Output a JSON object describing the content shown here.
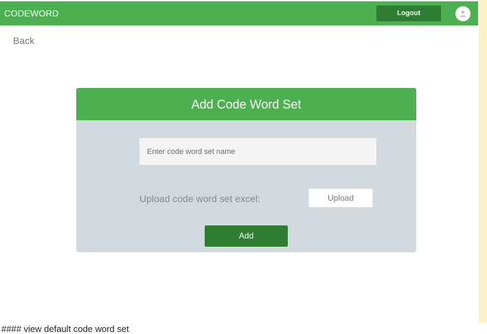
{
  "navbar": {
    "brand": "CODEWORD",
    "logout_label": "Logout",
    "avatar_icon": "user-avatar-icon"
  },
  "nav": {
    "back_label": "Back"
  },
  "form": {
    "title": "Add Code Word Set",
    "name_placeholder": "Enter code word set name",
    "name_value": "",
    "upload_label": "Upload code word set excel:",
    "upload_button": "Upload",
    "add_button": "Add"
  },
  "footer": {
    "text": "#### view default code word set"
  },
  "colors": {
    "primary_green": "#4caf50",
    "dark_green": "#2e7d32",
    "card_background": "#d1d8de",
    "side_strip": "#fdf1c6"
  }
}
